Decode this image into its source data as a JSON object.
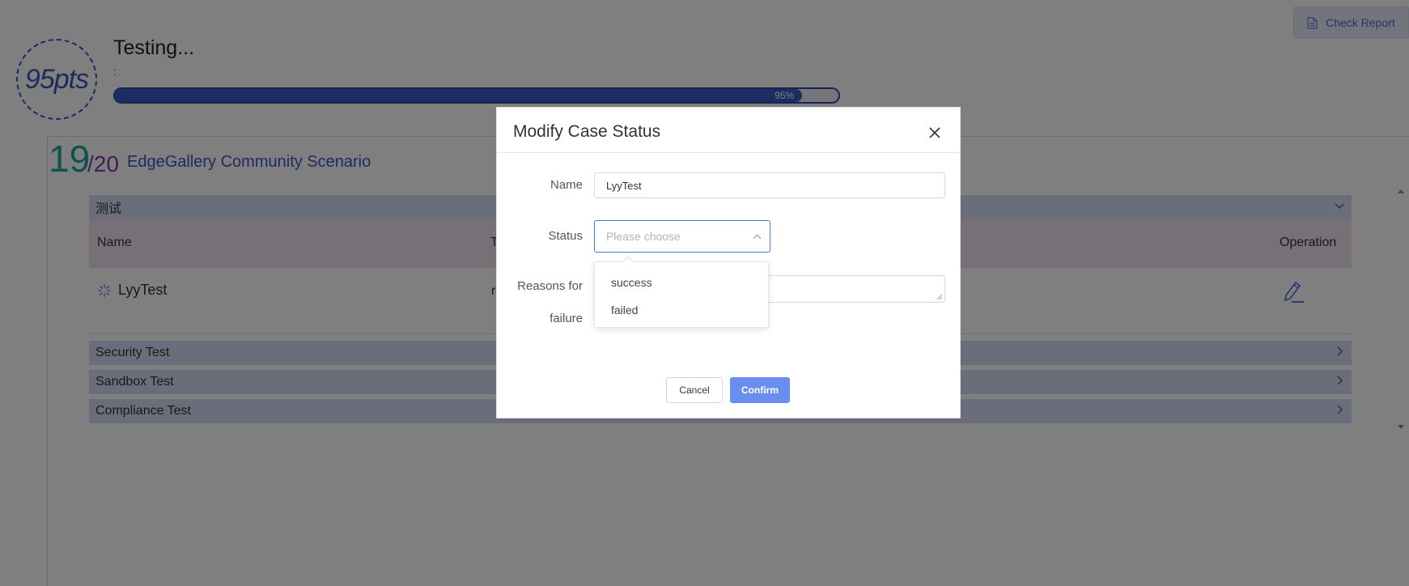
{
  "header": {
    "score": "95pts",
    "status_title": "Testing...",
    "status_subtitle": ":",
    "progress_percent": 95,
    "progress_label": "95%",
    "check_report_label": "Check Report"
  },
  "scenario": {
    "passed_count": "19",
    "total_count": "/20",
    "name": "EdgeGallery Community Scenario"
  },
  "groups": {
    "expanded": {
      "label": "测试",
      "columns": {
        "name": "Name",
        "type_truncated": "T",
        "operation": "Operation"
      },
      "row": {
        "name": "LyyTest",
        "truncated_cell": "r"
      }
    },
    "collapsed": [
      {
        "label": "Security Test"
      },
      {
        "label": "Sandbox Test"
      },
      {
        "label": "Compliance Test"
      }
    ]
  },
  "modal": {
    "title": "Modify Case Status",
    "name_label": "Name",
    "name_value": "LyyTest",
    "status_label": "Status",
    "status_placeholder": "Please choose",
    "reason_label_line1": "Reasons for",
    "reason_label_line2": "failure",
    "status_options": [
      "success",
      "failed"
    ],
    "cancel_label": "Cancel",
    "confirm_label": "Confirm"
  },
  "colors": {
    "accent": "#4e74e6",
    "confirm_button": "#6a8df0",
    "progress_fill": "#3a5bc6",
    "passed_count": "#1fa79a",
    "total_count": "#8a3bb0",
    "scenario_name": "#3f55c8"
  },
  "icons": {
    "report": "document-icon",
    "spinner": "loading-icon",
    "edit": "pencil-icon",
    "close": "close-icon",
    "expand": "chevron-down-icon",
    "collapse": "chevron-right-icon",
    "select": "chevron-up-icon"
  }
}
